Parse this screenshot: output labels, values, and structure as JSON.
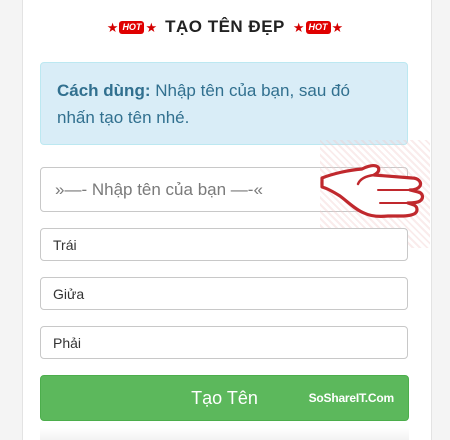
{
  "header": {
    "title": "TẠO TÊN ĐẸP",
    "hot_badge_text": "HOT"
  },
  "info": {
    "label": "Cách dùng:",
    "text": "Nhập tên của bạn, sau đó nhấn tạo tên nhé."
  },
  "form": {
    "name_placeholder": "»—- Nhập tên của bạn —-«",
    "left_placeholder": "Trái",
    "middle_placeholder": "Giửa",
    "right_placeholder": "Phải",
    "submit_label": "Tạo Tên"
  },
  "watermark": "SoShareIT.Com",
  "colors": {
    "button": "#5cb85c",
    "info_bg": "#d9edf7",
    "hot": "#e00000",
    "pointer": "#c0282d"
  }
}
